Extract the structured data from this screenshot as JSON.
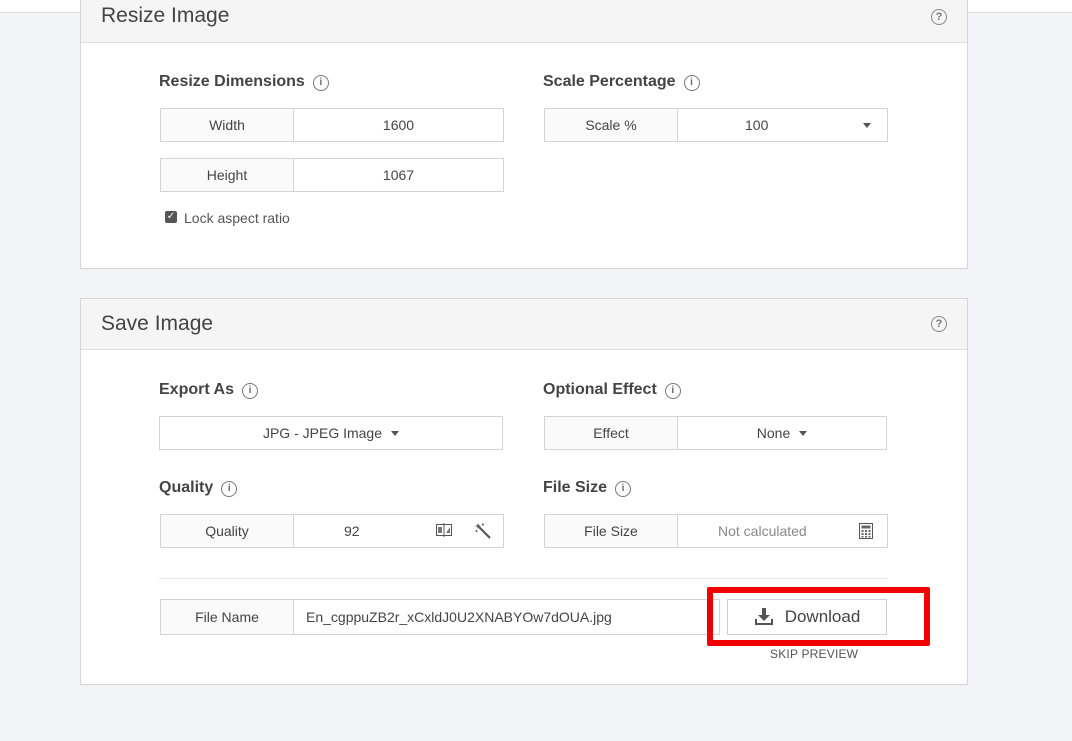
{
  "resize_panel": {
    "title": "Resize Image",
    "dimensions_label": "Resize Dimensions",
    "width_caption": "Width",
    "width_value": "1600",
    "height_caption": "Height",
    "height_value": "1067",
    "lock_label": "Lock aspect ratio",
    "lock_checked": true,
    "scale_label": "Scale Percentage",
    "scale_caption": "Scale %",
    "scale_value": "100"
  },
  "save_panel": {
    "title": "Save Image",
    "export_label": "Export As",
    "export_value": "JPG - JPEG Image",
    "effect_label": "Optional Effect",
    "effect_caption": "Effect",
    "effect_value": "None",
    "quality_label": "Quality",
    "quality_caption": "Quality",
    "quality_value": "92",
    "filesize_label": "File Size",
    "filesize_caption": "File Size",
    "filesize_value": "Not calculated",
    "filename_caption": "File Name",
    "filename_value": "En_cgppuZB2r_xCxldJ0U2XNABYOw7dOUA.jpg",
    "download_label": "Download",
    "skip_preview_label": "SKIP PREVIEW"
  },
  "colors": {
    "highlight": "#f00000",
    "background": "#f3f4f7"
  }
}
